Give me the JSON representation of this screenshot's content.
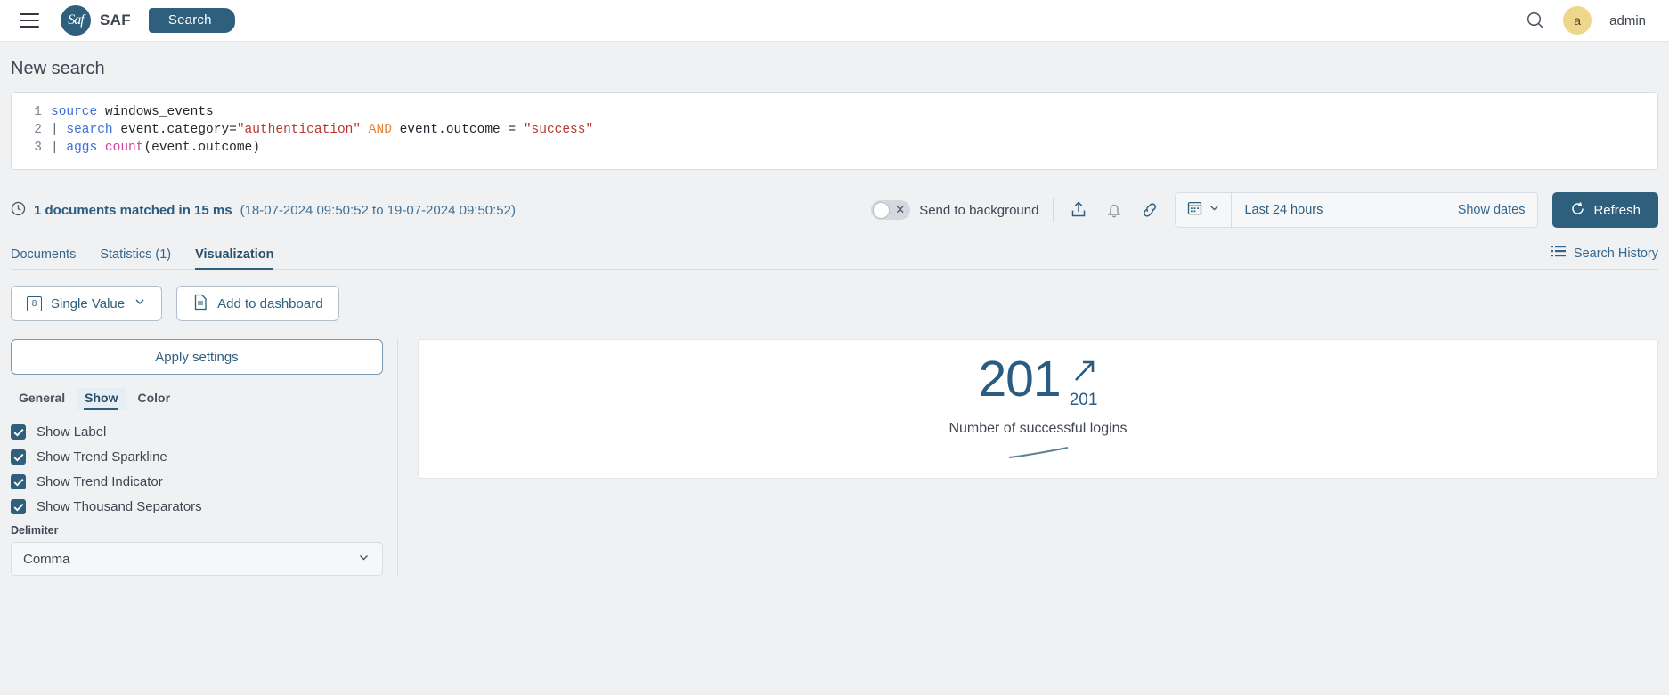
{
  "topnav": {
    "menu_icon": "hamburger-icon",
    "logo_text": "Saf",
    "brand": "SAF",
    "search_pill": "Search",
    "search_icon": "search-icon",
    "avatar_initial": "a",
    "username": "admin"
  },
  "page": {
    "title": "New search"
  },
  "query": {
    "lines": [
      {
        "num": "1",
        "tokens": [
          {
            "t": "source",
            "c": "cmd"
          },
          {
            "t": " windows_events",
            "c": "plain"
          }
        ]
      },
      {
        "num": "2",
        "tokens": [
          {
            "t": "| ",
            "c": "pipe"
          },
          {
            "t": "search",
            "c": "cmd"
          },
          {
            "t": " event.category=",
            "c": "plain"
          },
          {
            "t": "\"authentication\"",
            "c": "str"
          },
          {
            "t": " AND ",
            "c": "kw"
          },
          {
            "t": "event.outcome = ",
            "c": "plain"
          },
          {
            "t": "\"success\"",
            "c": "str"
          }
        ]
      },
      {
        "num": "3",
        "tokens": [
          {
            "t": "| ",
            "c": "pipe"
          },
          {
            "t": "aggs ",
            "c": "cmd"
          },
          {
            "t": "count",
            "c": "fn"
          },
          {
            "t": "(event.outcome)",
            "c": "plain"
          }
        ]
      }
    ]
  },
  "status": {
    "clock_icon": "clock-icon",
    "matched_text": "1 documents matched in 15 ms",
    "time_range": "(18-07-2024 09:50:52 to 19-07-2024 09:50:52)",
    "toggle_label": "Send to background",
    "toggle_state": "off",
    "share_icon": "share-icon",
    "bell_icon": "bell-icon",
    "link_icon": "link-icon"
  },
  "timepicker": {
    "calendar_icon": "calendar-icon",
    "chevron_icon": "chevron-down-icon",
    "value": "Last 24 hours",
    "show_dates": "Show dates",
    "refresh_label": "Refresh",
    "refresh_icon": "refresh-icon"
  },
  "tabs": {
    "items": [
      {
        "label": "Documents",
        "active": false
      },
      {
        "label": "Statistics (1)",
        "active": false
      },
      {
        "label": "Visualization",
        "active": true
      }
    ],
    "search_history": "Search History",
    "history_icon": "list-icon"
  },
  "viz_toolbar": {
    "chart_type_icon": "single-value-icon",
    "chart_type": "Single Value",
    "chevron_icon": "chevron-down-icon",
    "dashboard_icon": "document-icon",
    "add_to_dashboard": "Add to dashboard"
  },
  "settings": {
    "apply_label": "Apply settings",
    "subtabs": [
      {
        "label": "General",
        "active": false
      },
      {
        "label": "Show",
        "active": true
      },
      {
        "label": "Color",
        "active": false
      }
    ],
    "checkboxes": [
      {
        "label": "Show Label",
        "checked": true
      },
      {
        "label": "Show Trend Sparkline",
        "checked": true
      },
      {
        "label": "Show Trend Indicator",
        "checked": true
      },
      {
        "label": "Show Thousand Separators",
        "checked": true
      }
    ],
    "delimiter_label": "Delimiter",
    "delimiter_value": "Comma",
    "delimiter_chevron": "chevron-down-icon"
  },
  "visualization": {
    "value": "201",
    "trend_arrow_icon": "trend-up-arrow-icon",
    "trend_value": "201",
    "label": "Number of successful logins"
  },
  "colors": {
    "brand": "#2e5f7d",
    "accent_text": "#33668e",
    "avatar": "#eed78a",
    "page_bg": "#f0f1f3",
    "value_color": "#2a5b80"
  }
}
